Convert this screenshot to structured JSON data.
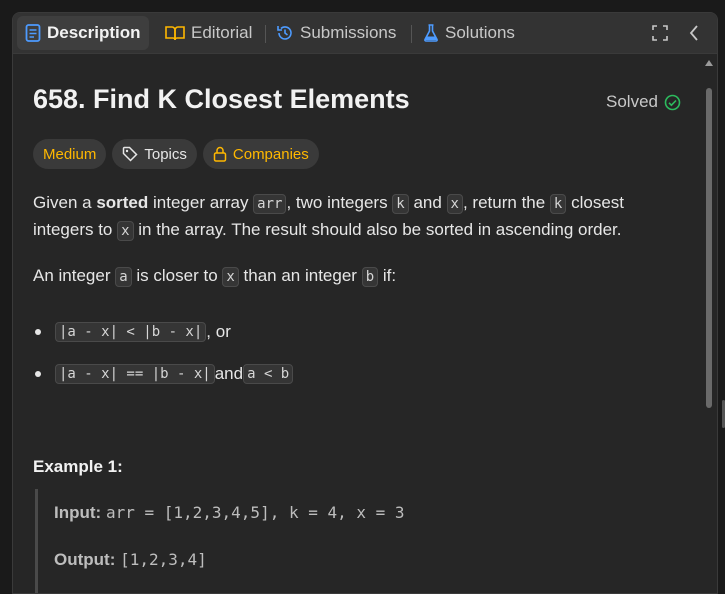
{
  "tabs": [
    {
      "label": "Description",
      "icon": "document-icon",
      "active": true
    },
    {
      "label": "Editorial",
      "icon": "book-icon",
      "active": false
    },
    {
      "label": "Submissions",
      "icon": "history-icon",
      "active": false
    },
    {
      "label": "Solutions",
      "icon": "flask-icon",
      "active": false
    }
  ],
  "toolbar": {
    "expand_icon": "expand-icon",
    "collapse_icon": "chevron-left-icon"
  },
  "problem": {
    "title": "658. Find K Closest Elements",
    "status": "Solved",
    "difficulty": "Medium",
    "topics_label": "Topics",
    "companies_label": "Companies"
  },
  "description": {
    "p1_a": "Given a ",
    "p1_bold": "sorted",
    "p1_b": " integer array ",
    "p1_code1": "arr",
    "p1_c": ", two integers ",
    "p1_code2": "k",
    "p1_d": " and ",
    "p1_code3": "x",
    "p1_e": ", return the ",
    "p1_code4": "k",
    "p1_f": " closest integers to ",
    "p1_code5": "x",
    "p1_g": " in the array. The result should also be sorted in ascending order.",
    "p2_a": "An integer ",
    "p2_code1": "a",
    "p2_b": " is closer to ",
    "p2_code2": "x",
    "p2_c": " than an integer ",
    "p2_code3": "b",
    "p2_d": " if:",
    "b1_code": "|a - x| < |b - x|",
    "b1_text": ", or",
    "b2_code1": "|a - x| == |b - x|",
    "b2_text": " and ",
    "b2_code2": "a < b"
  },
  "example": {
    "heading": "Example 1:",
    "input_label": "Input:",
    "input_value": "arr = [1,2,3,4,5], k = 4, x = 3",
    "output_label": "Output:",
    "output_value": "[1,2,3,4]"
  },
  "colors": {
    "accent_medium": "#ffb800",
    "solved_green": "#2cbb5d",
    "tab_blue": "#4d9bff"
  }
}
